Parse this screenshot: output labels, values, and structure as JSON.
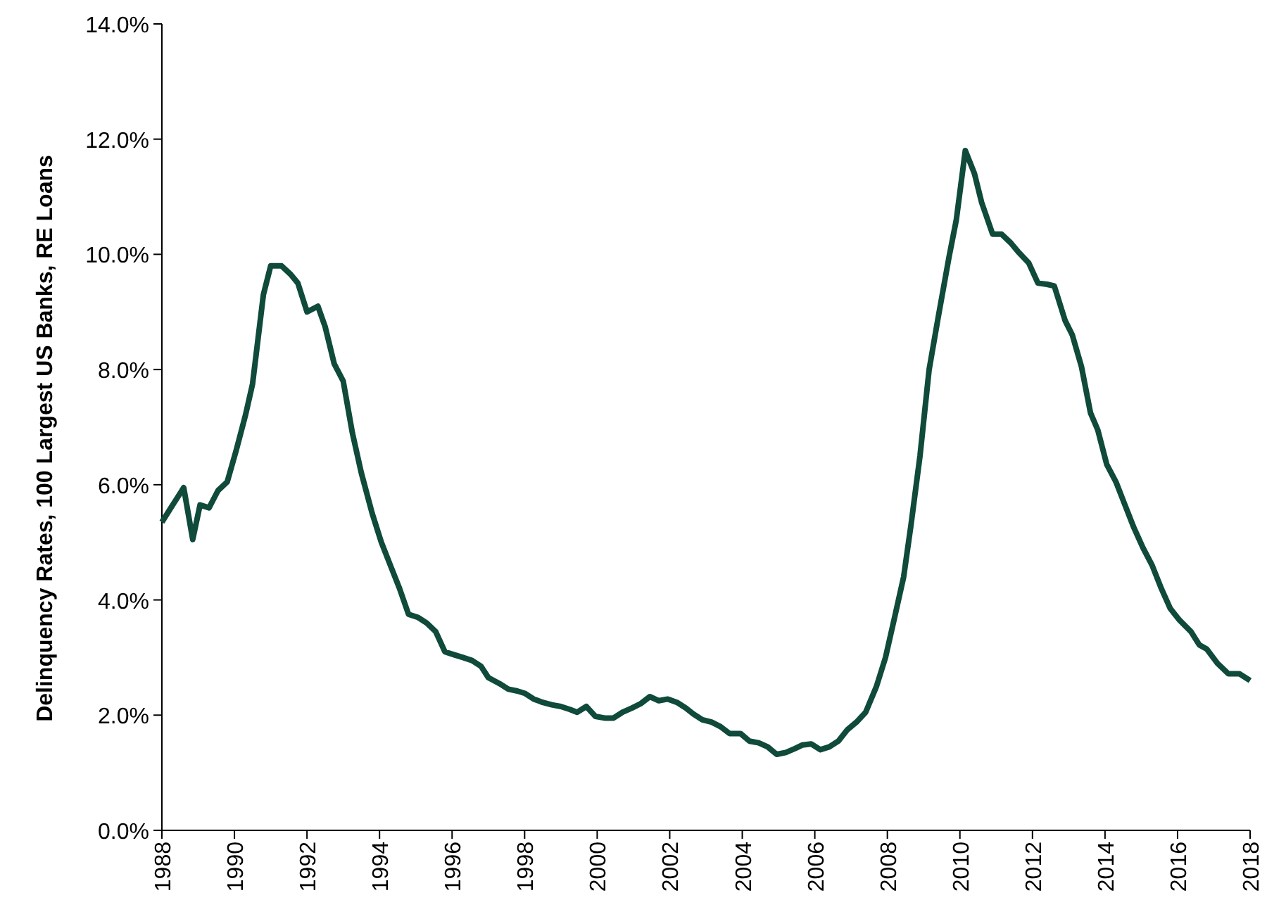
{
  "chart_data": {
    "type": "line",
    "ylabel": "Delinquency Rates, 100 Largest US Banks, RE Loans",
    "x": [
      1988,
      1988.25,
      1988.6,
      1988.85,
      1989.05,
      1989.3,
      1989.55,
      1989.8,
      1990.05,
      1990.3,
      1990.5,
      1990.8,
      1991,
      1991.3,
      1991.55,
      1991.75,
      1992,
      1992.3,
      1992.5,
      1992.75,
      1993,
      1993.25,
      1993.5,
      1993.8,
      1994.05,
      1994.3,
      1994.55,
      1994.8,
      1995.05,
      1995.3,
      1995.55,
      1995.8,
      1996.05,
      1996.3,
      1996.55,
      1996.8,
      1997,
      1997.3,
      1997.55,
      1997.8,
      1998,
      1998.25,
      1998.5,
      1998.75,
      1999,
      1999.25,
      1999.45,
      1999.7,
      1999.95,
      2000.2,
      2000.45,
      2000.7,
      2000.95,
      2001.2,
      2001.45,
      2001.7,
      2001.95,
      2002.2,
      2002.45,
      2002.65,
      2002.9,
      2003.15,
      2003.4,
      2003.65,
      2003.95,
      2004.2,
      2004.45,
      2004.7,
      2004.95,
      2005.2,
      2005.45,
      2005.65,
      2005.9,
      2006.15,
      2006.4,
      2006.65,
      2006.9,
      2007.15,
      2007.4,
      2007.7,
      2007.95,
      2008.2,
      2008.45,
      2008.65,
      2008.9,
      2009.15,
      2009.4,
      2009.7,
      2009.9,
      2010.15,
      2010.4,
      2010.6,
      2010.9,
      2011.15,
      2011.4,
      2011.6,
      2011.9,
      2012.15,
      2012.4,
      2012.6,
      2012.9,
      2013.1,
      2013.35,
      2013.6,
      2013.8,
      2014.05,
      2014.3,
      2014.55,
      2014.8,
      2015.05,
      2015.3,
      2015.55,
      2015.8,
      2016.05,
      2016.37,
      2016.6,
      2016.8,
      2017.1,
      2017.4,
      2017.7,
      2018
    ],
    "series": [
      {
        "color": "#0f4a3a",
        "values": [
          5.35,
          5.6,
          5.95,
          5.05,
          5.65,
          5.6,
          5.9,
          6.05,
          6.6,
          7.2,
          7.75,
          9.3,
          9.8,
          9.8,
          9.65,
          9.5,
          9.0,
          9.1,
          8.75,
          8.1,
          7.8,
          6.9,
          6.2,
          5.5,
          5.0,
          4.6,
          4.2,
          3.75,
          3.7,
          3.6,
          3.45,
          3.1,
          3.05,
          3.0,
          2.95,
          2.85,
          2.65,
          2.55,
          2.45,
          2.42,
          2.38,
          2.28,
          2.22,
          2.18,
          2.15,
          2.1,
          2.05,
          2.15,
          1.98,
          1.95,
          1.95,
          2.05,
          2.12,
          2.2,
          2.32,
          2.25,
          2.28,
          2.22,
          2.12,
          2.02,
          1.92,
          1.88,
          1.8,
          1.68,
          1.68,
          1.55,
          1.52,
          1.45,
          1.32,
          1.35,
          1.42,
          1.48,
          1.5,
          1.4,
          1.45,
          1.55,
          1.75,
          1.88,
          2.05,
          2.5,
          3.0,
          3.7,
          4.4,
          5.3,
          6.5,
          8.0,
          8.9,
          9.95,
          10.6,
          11.8,
          11.4,
          10.9,
          10.35,
          10.35,
          10.2,
          10.05,
          9.85,
          9.5,
          9.48,
          9.45,
          8.85,
          8.6,
          8.05,
          7.25,
          6.95,
          6.35,
          6.05,
          5.65,
          5.25,
          4.9,
          4.6,
          4.2,
          3.85,
          3.65,
          3.45,
          3.22,
          3.15,
          2.9,
          2.72,
          2.72,
          2.6
        ]
      }
    ],
    "xlim": [
      1988,
      2018
    ],
    "ylim": [
      0,
      14
    ],
    "xticks": [
      1988,
      1990,
      1992,
      1994,
      1996,
      1998,
      2000,
      2002,
      2004,
      2006,
      2008,
      2010,
      2012,
      2014,
      2016,
      2018
    ],
    "yticks": [
      {
        "value": 0,
        "label": "0.0%"
      },
      {
        "value": 2,
        "label": "2.0%"
      },
      {
        "value": 4,
        "label": "4.0%"
      },
      {
        "value": 6,
        "label": "6.0%"
      },
      {
        "value": 8,
        "label": "8.0%"
      },
      {
        "value": 10,
        "label": "10.0%"
      },
      {
        "value": 12,
        "label": "12.0%"
      },
      {
        "value": 14,
        "label": "14.0%"
      }
    ]
  }
}
